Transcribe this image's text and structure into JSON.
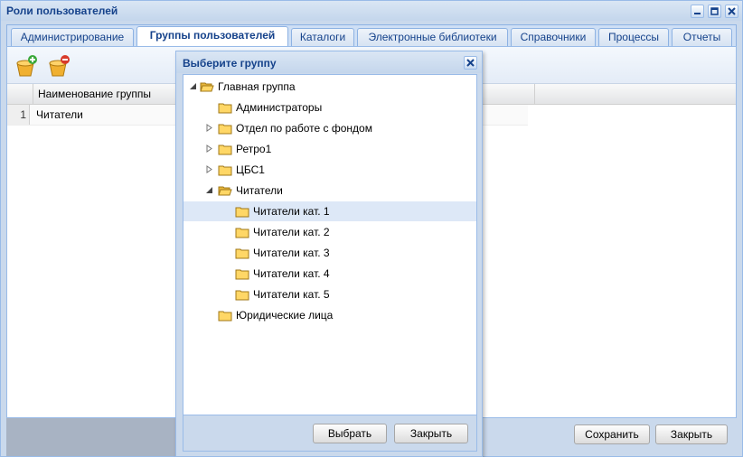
{
  "window": {
    "title": "Роли пользователей"
  },
  "tabs": [
    {
      "label": "Администрирование"
    },
    {
      "label": "Группы пользователей"
    },
    {
      "label": "Каталоги"
    },
    {
      "label": "Электронные библиотеки"
    },
    {
      "label": "Справочники"
    },
    {
      "label": "Процессы"
    },
    {
      "label": "Отчеты"
    }
  ],
  "grid": {
    "column_header": "Наименование группы",
    "rows": [
      {
        "num": "1",
        "name": "Читатели"
      }
    ]
  },
  "footer": {
    "save_label": "Сохранить",
    "close_label": "Закрыть"
  },
  "dialog": {
    "title": "Выберите группу",
    "tree": [
      {
        "label": "Главная группа"
      },
      {
        "label": "Администраторы"
      },
      {
        "label": "Отдел по работе с фондом"
      },
      {
        "label": "Ретро1"
      },
      {
        "label": "ЦБС1"
      },
      {
        "label": "Читатели"
      },
      {
        "label": "Читатели кат. 1"
      },
      {
        "label": "Читатели кат. 2"
      },
      {
        "label": "Читатели кат. 3"
      },
      {
        "label": "Читатели кат. 4"
      },
      {
        "label": "Читатели кат. 5"
      },
      {
        "label": "Юридические лица"
      }
    ],
    "select_label": "Выбрать",
    "close_label": "Закрыть"
  }
}
